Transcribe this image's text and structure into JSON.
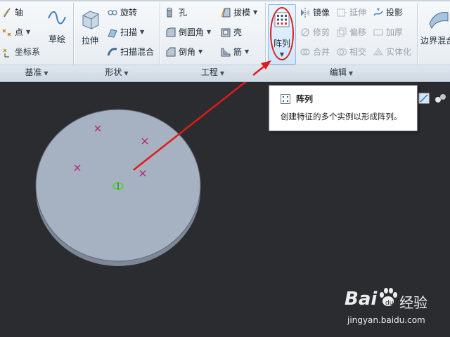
{
  "ribbon": {
    "datum": {
      "items": [
        {
          "label": "轴",
          "icon": "axis-icon"
        },
        {
          "label": "点",
          "icon": "point-icon",
          "has_dropdown": true
        },
        {
          "label": "坐标系",
          "icon": "coordinate-system-icon"
        }
      ],
      "big_button": {
        "label": "草绘",
        "icon": "sketch-icon"
      },
      "group_label": "基准"
    },
    "shapes": {
      "big_button": {
        "label": "拉伸",
        "icon": "extrude-icon"
      },
      "items": [
        {
          "label": "旋转",
          "icon": "revolve-icon"
        },
        {
          "label": "扫描",
          "icon": "sweep-icon",
          "has_dropdown": true
        },
        {
          "label": "扫描混合",
          "icon": "swept-blend-icon"
        }
      ],
      "group_label": "形状"
    },
    "engineering": {
      "col1": [
        {
          "label": "孔",
          "icon": "hole-icon"
        },
        {
          "label": "倒圆角",
          "icon": "round-icon",
          "has_dropdown": true
        },
        {
          "label": "倒角",
          "icon": "chamfer-icon",
          "has_dropdown": true
        }
      ],
      "col2": [
        {
          "label": "拔模",
          "icon": "draft-icon",
          "has_dropdown": true
        },
        {
          "label": "壳",
          "icon": "shell-icon"
        },
        {
          "label": "筋",
          "icon": "rib-icon",
          "has_dropdown": true
        }
      ],
      "group_label": "工程"
    },
    "editing": {
      "pattern_button": {
        "label": "阵列",
        "icon": "pattern-icon",
        "has_dropdown": true
      },
      "col1": [
        {
          "label": "镜像",
          "icon": "mirror-icon",
          "enabled": true
        },
        {
          "label": "修剪",
          "icon": "trim-icon",
          "enabled": false
        },
        {
          "label": "合并",
          "icon": "merge-icon",
          "enabled": false
        }
      ],
      "col2": [
        {
          "label": "延伸",
          "icon": "extend-icon",
          "enabled": false
        },
        {
          "label": "偏移",
          "icon": "offset-icon",
          "enabled": false
        },
        {
          "label": "相交",
          "icon": "intersect-icon",
          "enabled": false
        }
      ],
      "col3": [
        {
          "label": "投影",
          "icon": "project-icon",
          "enabled": true
        },
        {
          "label": "加厚",
          "icon": "thicken-icon",
          "enabled": false
        },
        {
          "label": "实体化",
          "icon": "solidify-icon",
          "enabled": false
        }
      ],
      "group_label": "编辑"
    },
    "surfaces": {
      "big_button": {
        "label": "边界混合",
        "icon": "boundary-blend-icon"
      }
    }
  },
  "tooltip": {
    "title": "阵列",
    "description": "创建特征的多个实例以形成阵列。",
    "icon": "pattern-icon"
  },
  "watermark": {
    "brand": "Bai",
    "brand_suffix": "经验",
    "url": "jingyan.baidu.com"
  },
  "colors": {
    "viewport_bg": "#2b2c30",
    "part_fill": "#a6b1c1",
    "annotation_red": "#e01a1a",
    "marker": "#b0287a",
    "highlight_green": "#58d04a"
  }
}
